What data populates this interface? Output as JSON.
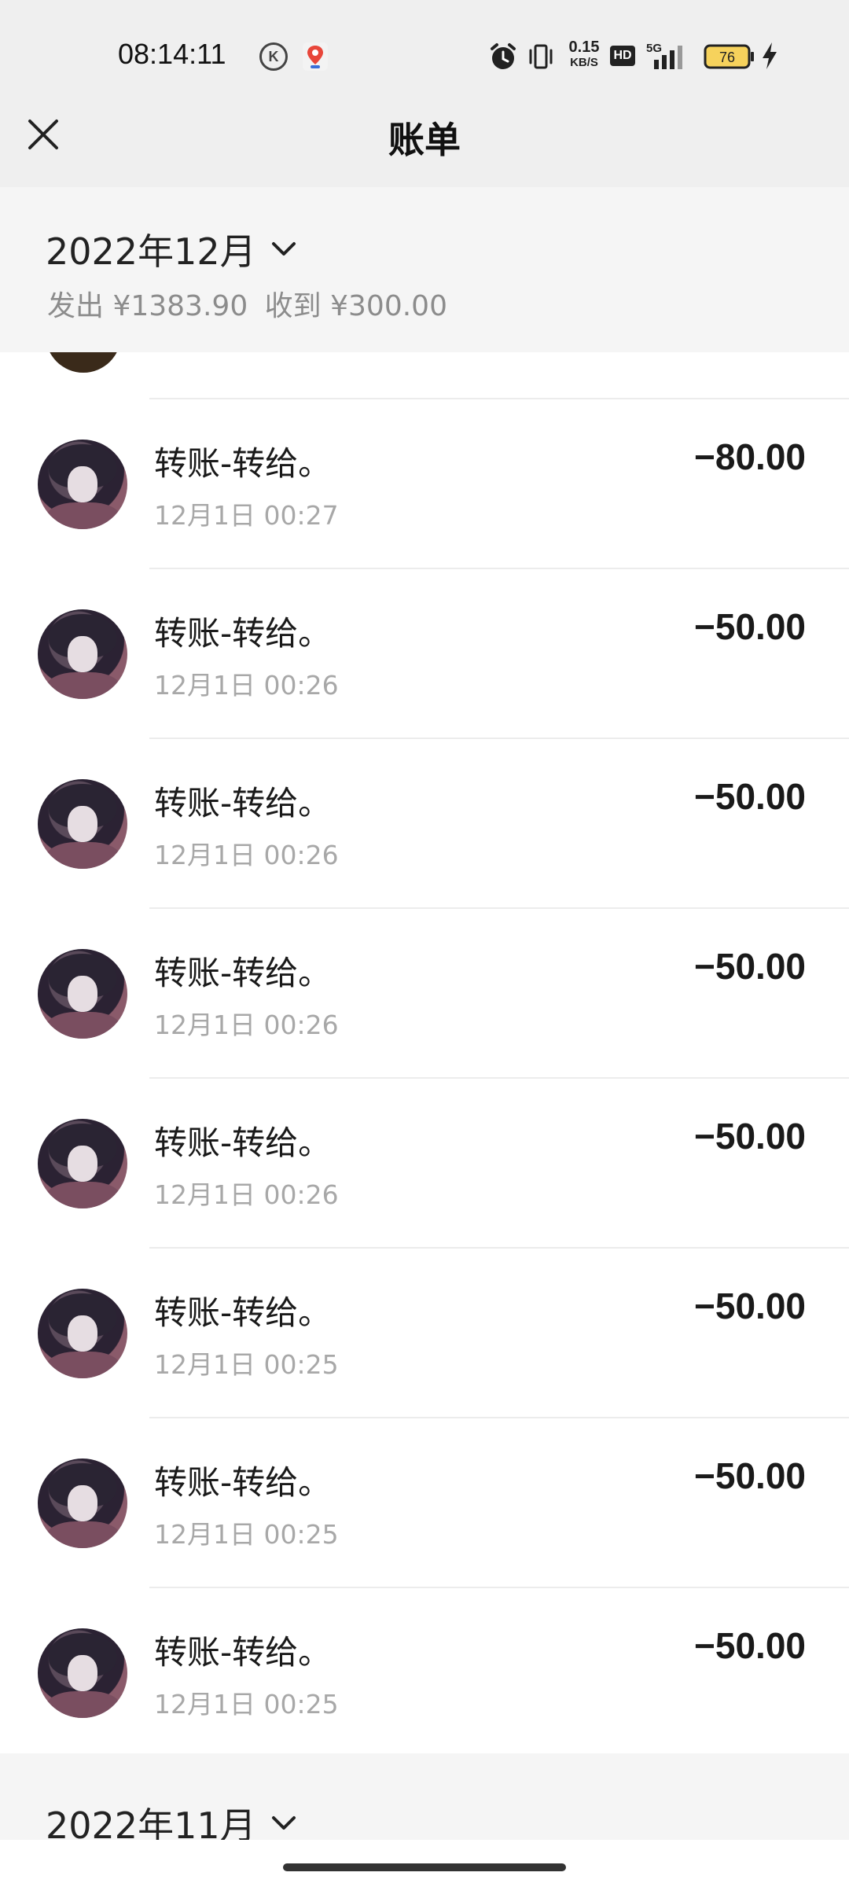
{
  "status_bar": {
    "time": "08:14:11",
    "net_speed_value": "0.15",
    "net_speed_unit": "KB/S",
    "hd_label": "HD",
    "network_type": "5G",
    "battery_level": "76"
  },
  "header": {
    "title": "账单"
  },
  "current_month": {
    "label": "2022年12月",
    "sent_label": "发出 ¥1383.90",
    "received_label": "收到 ¥300.00"
  },
  "transactions": [
    {
      "title": "转账-转给。",
      "time": "12月1日 00:27",
      "amount": "−80.00"
    },
    {
      "title": "转账-转给。",
      "time": "12月1日 00:26",
      "amount": "−50.00"
    },
    {
      "title": "转账-转给。",
      "time": "12月1日 00:26",
      "amount": "−50.00"
    },
    {
      "title": "转账-转给。",
      "time": "12月1日 00:26",
      "amount": "−50.00"
    },
    {
      "title": "转账-转给。",
      "time": "12月1日 00:26",
      "amount": "−50.00"
    },
    {
      "title": "转账-转给。",
      "time": "12月1日 00:25",
      "amount": "−50.00"
    },
    {
      "title": "转账-转给。",
      "time": "12月1日 00:25",
      "amount": "−50.00"
    },
    {
      "title": "转账-转给。",
      "time": "12月1日 00:25",
      "amount": "−50.00"
    }
  ],
  "next_month": {
    "label": "2022年11月"
  },
  "colors": {
    "header_bg": "#efefef",
    "summary_bg": "#f5f5f5",
    "secondary_text": "#a8a8a8",
    "battery_fill": "#f6d25c"
  }
}
